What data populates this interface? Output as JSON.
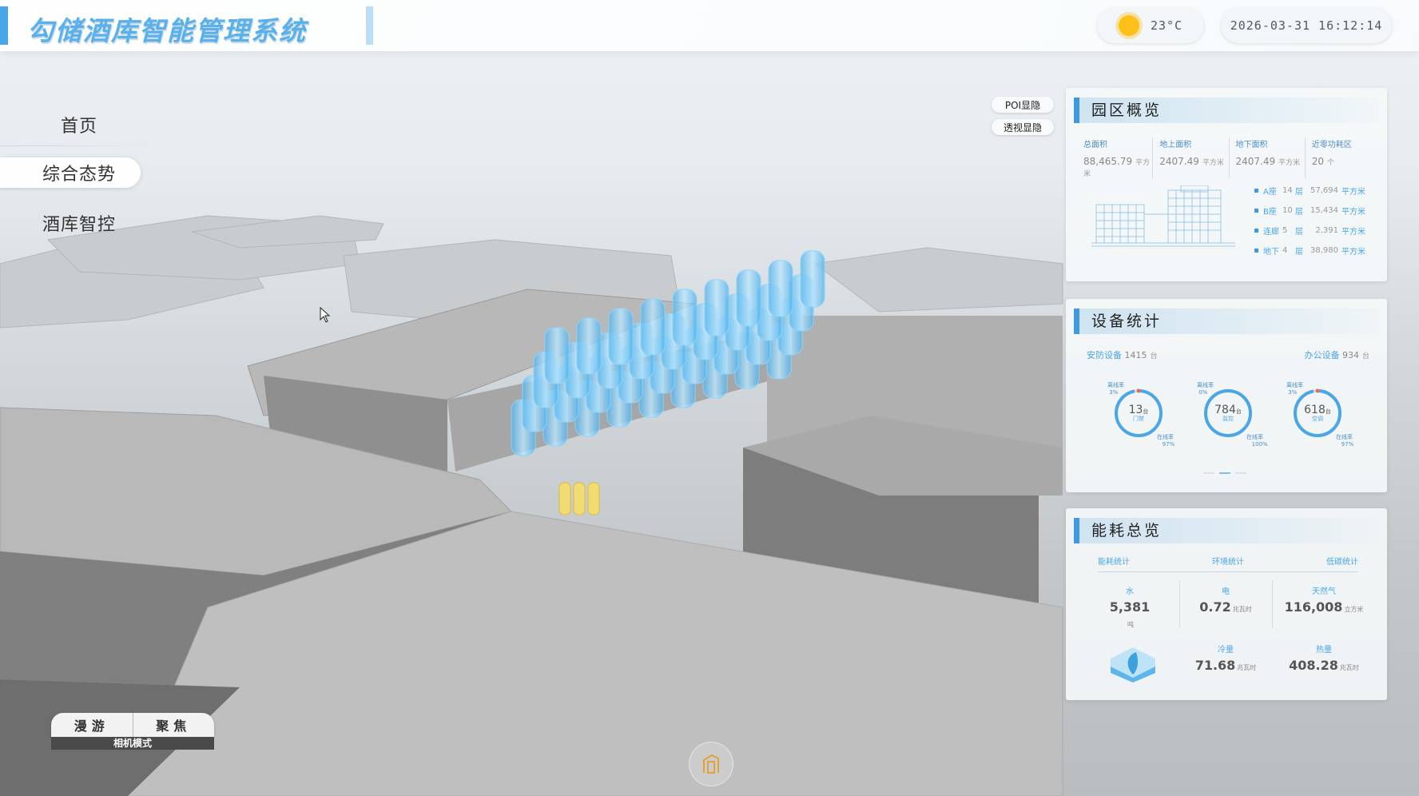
{
  "header": {
    "title": "勾储酒库智能管理系统",
    "weather": {
      "temp": "23°C",
      "icon": "sun-icon"
    },
    "datetime": "2026-03-31 16:12:14"
  },
  "nav": {
    "items": [
      {
        "label": "首页",
        "active": false
      },
      {
        "label": "综合态势",
        "active": true
      },
      {
        "label": "酒库智控",
        "active": false
      }
    ]
  },
  "toggles": {
    "poi": "POI显隐",
    "perspective": "透视显隐"
  },
  "park": {
    "title": "园区概览",
    "stats": [
      {
        "label": "总面积",
        "value": "88,465.79",
        "unit": "平方米"
      },
      {
        "label": "地上面积",
        "value": "2407.49",
        "unit": "平方米"
      },
      {
        "label": "地下面积",
        "value": "2407.49",
        "unit": "平方米"
      },
      {
        "label": "近零功耗区",
        "value": "20",
        "unit": "个"
      }
    ],
    "floors": [
      {
        "name": "A座",
        "count": "14",
        "unit": "层",
        "area": "57,694",
        "area_unit": "平方米"
      },
      {
        "name": "B座",
        "count": "10",
        "unit": "层",
        "area": "15,434",
        "area_unit": "平方米"
      },
      {
        "name": "连廊",
        "count": "5",
        "unit": "层",
        "area": "2,391",
        "area_unit": "平方米"
      },
      {
        "name": "地下",
        "count": "4",
        "unit": "层",
        "area": "38,980",
        "area_unit": "平方米"
      }
    ]
  },
  "equipment": {
    "title": "设备统计",
    "security": {
      "label": "安防设备",
      "value": "1415",
      "unit": "台"
    },
    "office": {
      "label": "办公设备",
      "value": "934",
      "unit": "台"
    },
    "donuts": [
      {
        "value": "13",
        "unit": "台",
        "name": "门禁",
        "off_label": "离线率",
        "off": "3",
        "on_label": "在线率",
        "on": "97",
        "pct_sign": "%",
        "on_rate": 0.97
      },
      {
        "value": "784",
        "unit": "台",
        "name": "监控",
        "off_label": "离线率",
        "off": "0",
        "on_label": "在线率",
        "on": "100",
        "pct_sign": "%",
        "on_rate": 1.0
      },
      {
        "value": "618",
        "unit": "台",
        "name": "空调",
        "off_label": "离线率",
        "off": "3",
        "on_label": "在线率",
        "on": "97",
        "pct_sign": "%",
        "on_rate": 0.97
      }
    ]
  },
  "energy": {
    "title": "能耗总览",
    "tabs": [
      "能耗统计",
      "环境统计",
      "低碳统计"
    ],
    "items": [
      {
        "label": "水",
        "value": "5,381",
        "unit": "吨"
      },
      {
        "label": "电",
        "value": "0.72",
        "unit": "兆瓦时"
      },
      {
        "label": "天然气",
        "value": "116,008",
        "unit": "立方米"
      },
      {
        "label": "冷量",
        "value": "71.68",
        "unit": "兆瓦时"
      },
      {
        "label": "热量",
        "value": "408.28",
        "unit": "兆瓦时"
      }
    ]
  },
  "camera": {
    "roam": "漫游",
    "focus": "聚焦",
    "caption": "相机模式"
  },
  "colors": {
    "accent": "#4aa6e6",
    "title": "#5ab0ea",
    "sun": "#ffc01a",
    "tank": "#6cc6f2"
  }
}
